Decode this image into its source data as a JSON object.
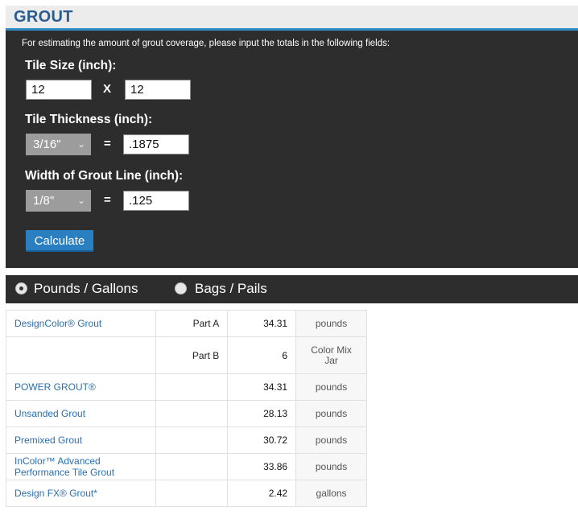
{
  "header": {
    "title": "GROUT"
  },
  "form": {
    "intro": "For estimating the amount of grout coverage, please input the totals in the following fields:",
    "tile_size": {
      "label": "Tile Size (inch):",
      "width": "12",
      "separator": "X",
      "height": "12"
    },
    "tile_thickness": {
      "label": "Tile Thickness (inch):",
      "select": "3/16\"",
      "equals": "=",
      "value": ".1875"
    },
    "grout_width": {
      "label": "Width of Grout Line (inch):",
      "select": "1/8\"",
      "equals": "=",
      "value": ".125"
    },
    "calculate_label": "Calculate"
  },
  "units_toggle": {
    "options": [
      {
        "label": "Pounds / Gallons",
        "selected": true
      },
      {
        "label": "Bags / Pails",
        "selected": false
      }
    ]
  },
  "results": {
    "rows": [
      {
        "name": "DesignColor® Grout",
        "part": "Part A",
        "value": "34.31",
        "unit": "pounds"
      },
      {
        "name": "",
        "part": "Part B",
        "value": "6",
        "unit": "Color Mix Jar"
      },
      {
        "name": "POWER GROUT®",
        "part": "",
        "value": "34.31",
        "unit": "pounds"
      },
      {
        "name": "Unsanded Grout",
        "part": "",
        "value": "28.13",
        "unit": "pounds"
      },
      {
        "name": "Premixed Grout",
        "part": "",
        "value": "30.72",
        "unit": "pounds"
      },
      {
        "name": "InColor™ Advanced Performance Tile Grout",
        "part": "",
        "value": "33.86",
        "unit": "pounds"
      },
      {
        "name": "Design FX® Grout*",
        "part": "",
        "value": "2.42",
        "unit": "gallons"
      }
    ]
  },
  "colors": {
    "accent": "#2f8ec4",
    "title": "#2a5d8f",
    "panel": "#2d2d2d",
    "button": "#2a7fc0",
    "link": "#2a6fb0"
  }
}
